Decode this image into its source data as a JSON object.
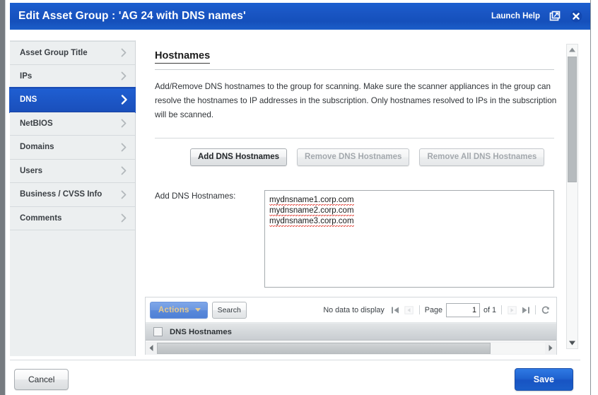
{
  "window": {
    "title": "Edit Asset Group : 'AG 24 with DNS names'",
    "launch_help_label": "Launch Help",
    "popout_icon": "popout-icon",
    "close_icon": "close-icon",
    "titlebar_color": "#1a57c6"
  },
  "sidebar": {
    "items": [
      {
        "label": "Asset Group Title",
        "active": false
      },
      {
        "label": "IPs",
        "active": false
      },
      {
        "label": "DNS",
        "active": true
      },
      {
        "label": "NetBIOS",
        "active": false
      },
      {
        "label": "Domains",
        "active": false
      },
      {
        "label": "Users",
        "active": false
      },
      {
        "label": "Business / CVSS Info",
        "active": false
      },
      {
        "label": "Comments",
        "active": false
      }
    ],
    "active_color": "#1d55c4"
  },
  "content": {
    "heading": "Hostnames",
    "description": "Add/Remove DNS hostnames to the group for scanning. Make sure the scanner appliances in the group can resolve the hostnames to IP addresses in the subscription. Only hostnames resolved to IPs in the subscription will be scanned.",
    "buttons": {
      "add": {
        "label": "Add DNS Hostnames",
        "disabled": false
      },
      "remove": {
        "label": "Remove DNS Hostnames",
        "disabled": true
      },
      "remove_all": {
        "label": "Remove All DNS Hostnames",
        "disabled": true
      }
    },
    "field": {
      "label": "Add DNS Hostnames:",
      "value": "mydnsname1.corp.com\nmydnsname2.corp.com\nmydnsname3.corp.com",
      "placeholder": "",
      "lines": [
        "mydnsname1.corp.com",
        "mydnsname2.corp.com",
        "mydnsname3.corp.com"
      ],
      "spellcheck_underline_color": "#e03b30"
    }
  },
  "grid": {
    "actions_label": "Actions",
    "search_label": "Search",
    "status_text": "No data to display",
    "page_label": "Page",
    "page_value": "1",
    "of_label": "of 1",
    "refresh_icon": "refresh-icon",
    "first_page_icon": "first-page-icon",
    "prev_page_icon": "prev-page-icon",
    "next_page_icon": "next-page-icon",
    "last_page_icon": "last-page-icon",
    "column_header": "DNS Hostnames",
    "select_all_checkbox": "select-all-checkbox",
    "actions_button_color": "#6b96df"
  },
  "footer": {
    "cancel_label": "Cancel",
    "save_label": "Save",
    "save_color": "#1f62cf"
  }
}
